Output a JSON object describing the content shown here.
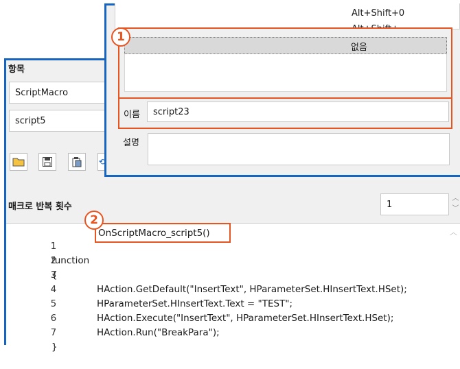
{
  "panel": {
    "section_label": "항목",
    "macro_type": "ScriptMacro",
    "macro_name": "script5",
    "repeat_label": "매크로 반복 횟수",
    "repeat_value": "1"
  },
  "toolbar": {
    "icons": [
      "open-folder-icon",
      "save-icon",
      "paste-icon",
      "more-icon"
    ]
  },
  "code": {
    "lines": [
      {
        "num": "1",
        "pre": "function ",
        "fn": "OnScriptMacro_script5()"
      },
      {
        "num": "2",
        "text": "{"
      },
      {
        "num": "3",
        "text": "HAction.GetDefault(\"InsertText\", HParameterSet.HInsertText.HSet);"
      },
      {
        "num": "4",
        "text": "HParameterSet.HInsertText.Text = \"TEST\";"
      },
      {
        "num": "5",
        "text": "HAction.Execute(\"InsertText\", HParameterSet.HInsertText.HSet);"
      },
      {
        "num": "6",
        "text": "HAction.Run(\"BreakPara\");"
      },
      {
        "num": "7",
        "text": "}"
      }
    ]
  },
  "dialog": {
    "shortcuts": [
      "Alt+Shift+0",
      "Alt+Shift+−",
      "없음"
    ],
    "name_label": "이름",
    "name_value": "script23",
    "desc_label": "설명",
    "desc_value": ""
  },
  "callouts": {
    "one": "1",
    "two": "2"
  },
  "colors": {
    "highlight": "#e8541f",
    "frame": "#1565c0",
    "selected_row": "#d9d9d9"
  }
}
